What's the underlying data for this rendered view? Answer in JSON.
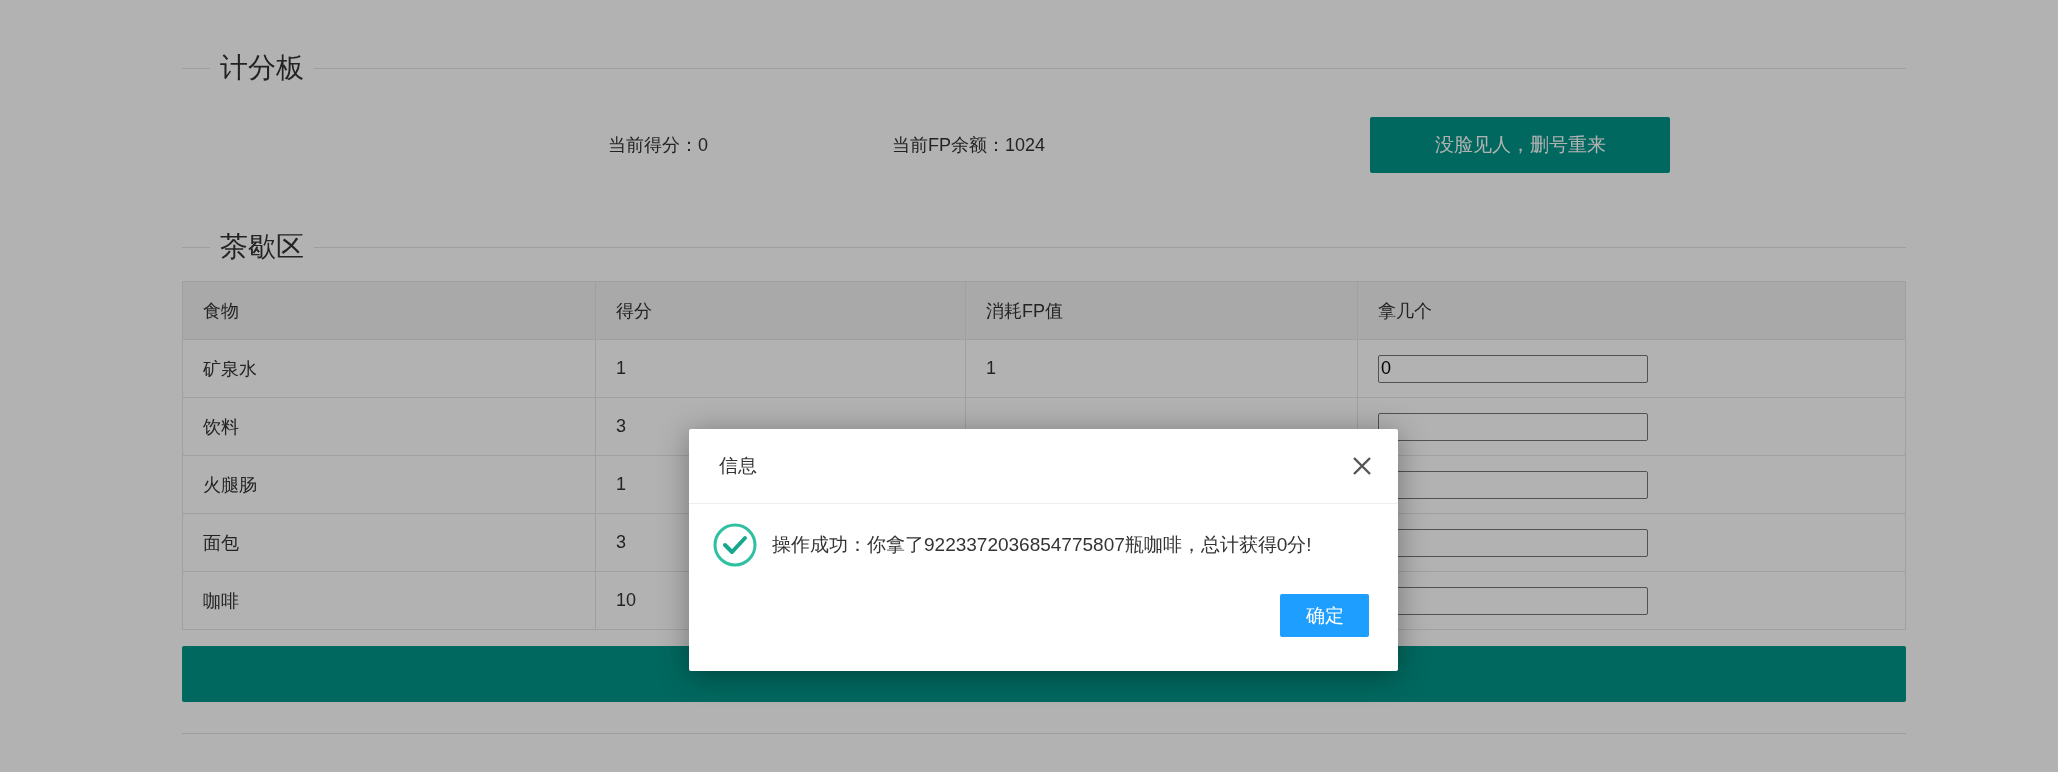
{
  "scoreboard": {
    "title": "计分板",
    "score_text": "当前得分：0",
    "fp_text": "当前FP余额：1024",
    "reset_button": "没脸见人，删号重来"
  },
  "break_area": {
    "title": "茶歇区",
    "columns": [
      "食物",
      "得分",
      "消耗FP值",
      "拿几个"
    ],
    "rows": [
      {
        "food": "矿泉水",
        "score": "1",
        "fp_cost": "1",
        "quantity": "0"
      },
      {
        "food": "饮料",
        "score": "3"
      },
      {
        "food": "火腿肠",
        "score": "1"
      },
      {
        "food": "面包",
        "score": "3"
      },
      {
        "food": "咖啡",
        "score": "10"
      }
    ]
  },
  "dialog": {
    "title": "信息",
    "message": "操作成功：你拿了9223372036854775807瓶咖啡，总计获得0分!",
    "ok_button": "确定"
  }
}
